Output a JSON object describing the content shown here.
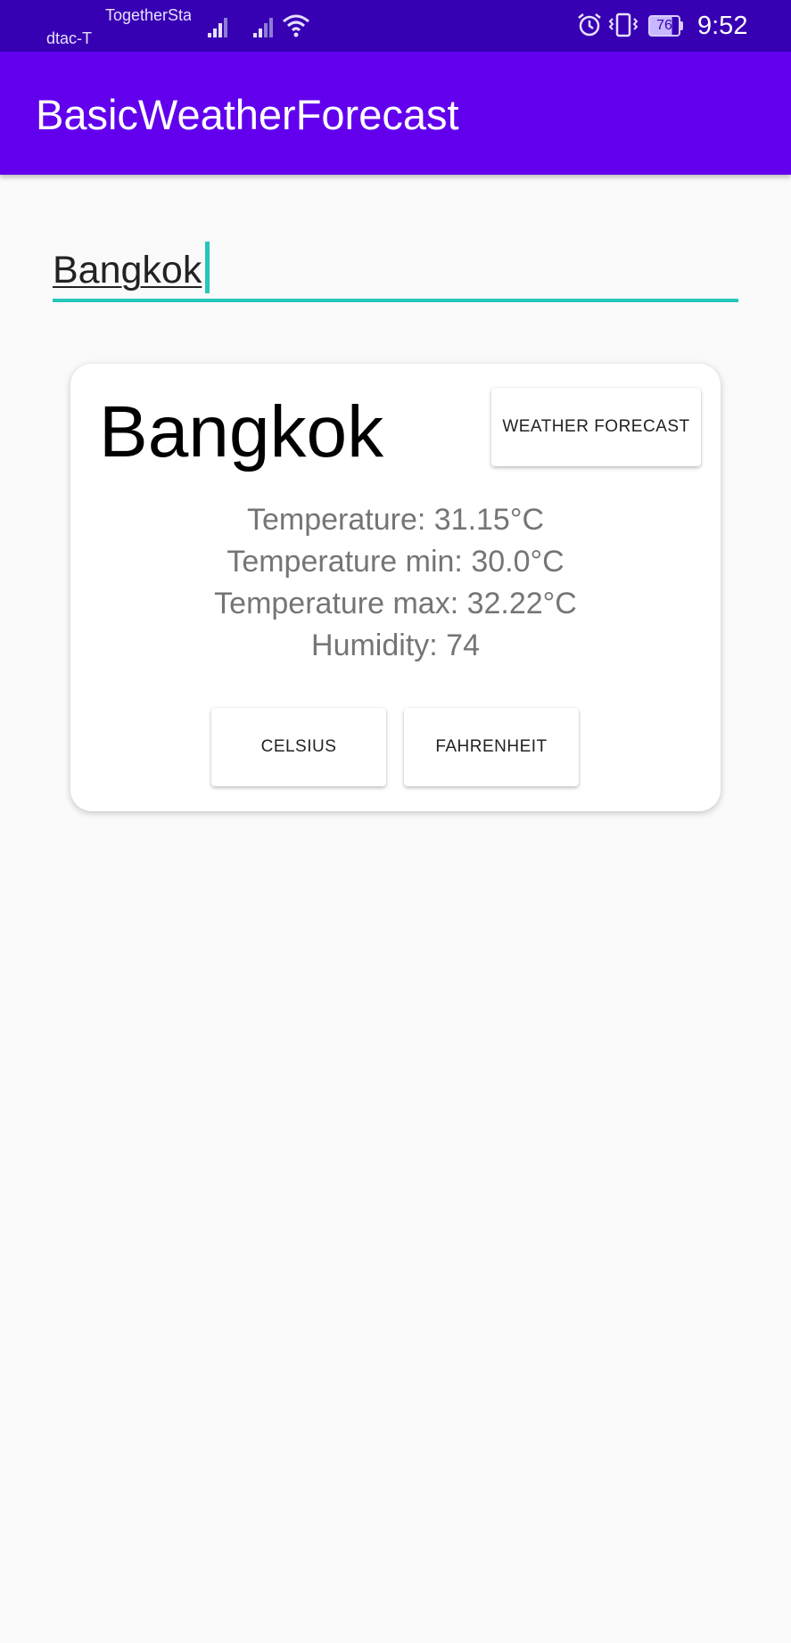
{
  "status_bar": {
    "carrier_primary": "dtac-T",
    "carrier_secondary": "TogetherSta",
    "battery_level": "76",
    "time": "9:52",
    "icons": [
      "signal-icon",
      "signal-icon",
      "wifi-icon",
      "alarm-icon",
      "vibrate-icon",
      "battery-icon"
    ]
  },
  "app_bar": {
    "title": "BasicWeatherForecast",
    "background_color": "#6200ee"
  },
  "search": {
    "value": "Bangkok",
    "accent_color": "#26c6b9"
  },
  "weather_card": {
    "city": "Bangkok",
    "forecast_button": "WEATHER FORECAST",
    "temperature": "Temperature: 31.15°C",
    "temperature_min": "Temperature min: 30.0°C",
    "temperature_max": "Temperature max: 32.22°C",
    "humidity": "Humidity: 74",
    "celsius_button": "CELSIUS",
    "fahrenheit_button": "FAHRENHEIT"
  }
}
